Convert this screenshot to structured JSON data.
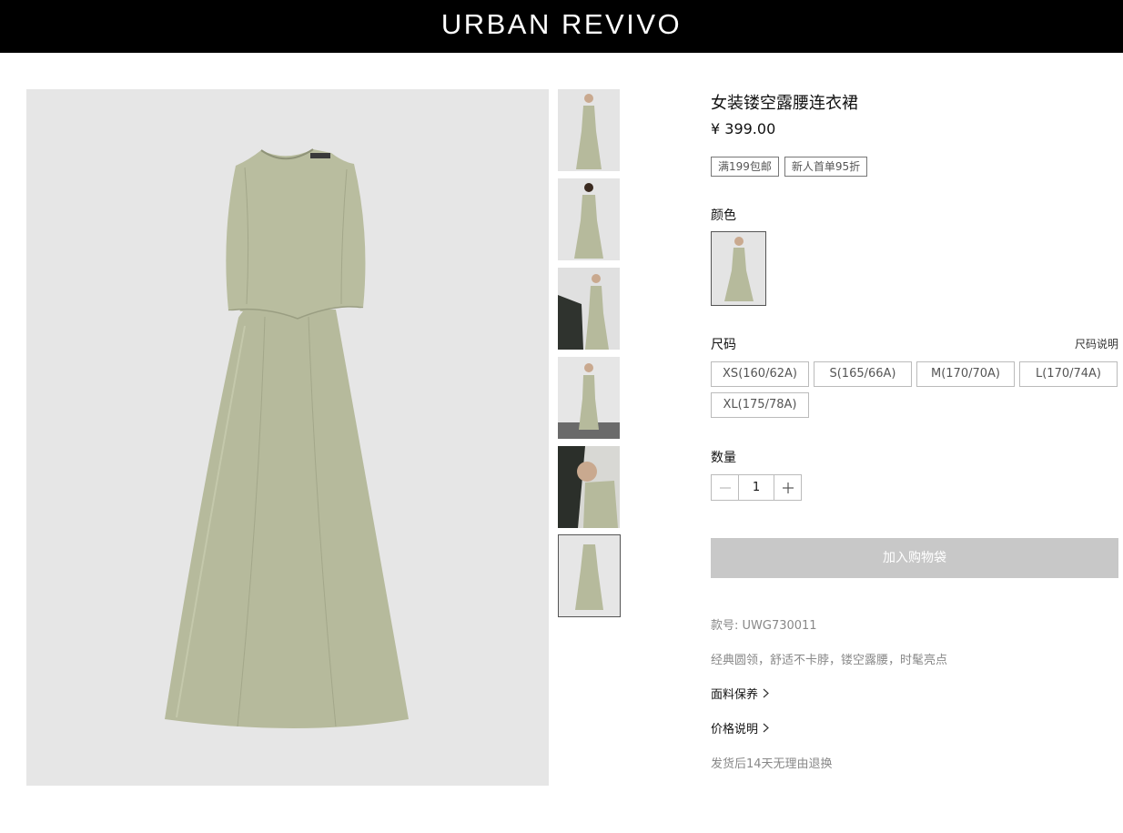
{
  "header": {
    "brand": "URBAN REVIVO"
  },
  "gallery": {
    "thumbnails": [
      {
        "alt": "front-view"
      },
      {
        "alt": "back-view"
      },
      {
        "alt": "side-view"
      },
      {
        "alt": "walking-view"
      },
      {
        "alt": "close-up"
      },
      {
        "alt": "flat-product",
        "active": true
      }
    ]
  },
  "product": {
    "title": "女装镂空露腰连衣裙",
    "price": "¥ 399.00",
    "tags": [
      "满199包邮",
      "新人首单95折"
    ],
    "color_label": "颜色",
    "size_label": "尺码",
    "size_guide": "尺码说明",
    "sizes": [
      "XS(160/62A)",
      "S(165/66A)",
      "M(170/70A)",
      "L(170/74A)",
      "XL(175/78A)"
    ],
    "quantity_label": "数量",
    "quantity": "1",
    "add_to_bag": "加入购物袋",
    "sku": "款号: UWG730011",
    "description": "经典圆领，舒适不卡脖，镂空露腰，时髦亮点",
    "fabric_care": "面料保养",
    "price_info": "价格说明",
    "return_policy": "发货后14天无理由退换"
  },
  "colors": {
    "dress": "#b9bd9f",
    "dress_shadow": "#a7ab8d",
    "background": "#e6e6e6",
    "button_disabled": "#c8c8c8"
  }
}
